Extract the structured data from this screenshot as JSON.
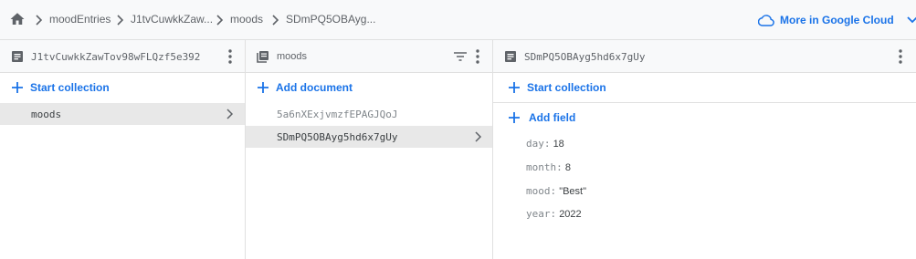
{
  "breadcrumb": {
    "items": [
      "moodEntries",
      "J1tvCuwkkZaw...",
      "moods",
      "SDmPQ5OBAyg..."
    ],
    "cloud_link": "More in Google Cloud"
  },
  "panel_root": {
    "title": "J1tvCuwkkZawTov98wFLQzf5e392",
    "start_collection": "Start collection",
    "collections": [
      "moods"
    ]
  },
  "panel_collection": {
    "title": "moods",
    "add_document": "Add document",
    "documents": [
      "5a6nXExjvmzfEPAGJQoJ",
      "SDmPQ5OBAyg5hd6x7gUy"
    ]
  },
  "panel_document": {
    "title": "SDmPQ5OBAyg5hd6x7gUy",
    "start_collection": "Start collection",
    "add_field": "Add field",
    "fields": [
      {
        "key": "day:",
        "value": "18"
      },
      {
        "key": "month:",
        "value": "8"
      },
      {
        "key": "mood:",
        "value": "\"Best\""
      },
      {
        "key": "year:",
        "value": "2022"
      }
    ]
  },
  "colors": {
    "accent": "#1a73e8",
    "selected_row": "#e8e8e8",
    "header_bg": "#f8f9fa"
  }
}
